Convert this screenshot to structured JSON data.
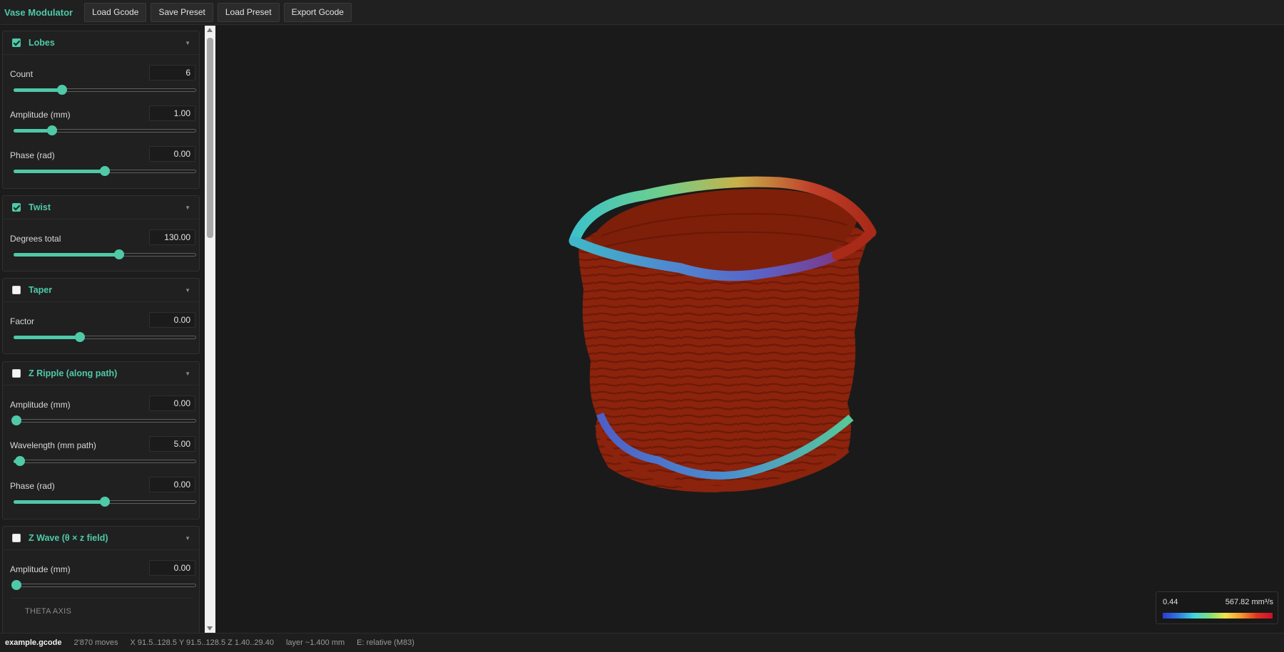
{
  "app": {
    "title": "Vase Modulator",
    "buttons": [
      "Load Gcode",
      "Save Preset",
      "Load Preset",
      "Export Gcode"
    ]
  },
  "panels": {
    "lobes": {
      "title": "Lobes",
      "enabled": true,
      "rows": [
        {
          "label": "Count",
          "value": "6",
          "slider_fraction": 0.26
        },
        {
          "label": "Amplitude (mm)",
          "value": "1.00",
          "slider_fraction": 0.2
        },
        {
          "label": "Phase (rad)",
          "value": "0.00",
          "slider_fraction": 0.5
        }
      ]
    },
    "twist": {
      "title": "Twist",
      "enabled": true,
      "rows": [
        {
          "label": "Degrees total",
          "value": "130.00",
          "slider_fraction": 0.58
        }
      ]
    },
    "taper": {
      "title": "Taper",
      "enabled": false,
      "rows": [
        {
          "label": "Factor",
          "value": "0.00",
          "slider_fraction": 0.36
        }
      ]
    },
    "zripple": {
      "title": "Z Ripple (along path)",
      "enabled": false,
      "rows": [
        {
          "label": "Amplitude (mm)",
          "value": "0.00",
          "slider_fraction": 0.0
        },
        {
          "label": "Wavelength (mm path)",
          "value": "5.00",
          "slider_fraction": 0.02
        },
        {
          "label": "Phase (rad)",
          "value": "0.00",
          "slider_fraction": 0.5
        }
      ]
    },
    "zwave": {
      "title": "Z Wave (θ × z field)",
      "enabled": false,
      "rows": [
        {
          "label": "Amplitude (mm)",
          "value": "0.00",
          "slider_fraction": 0.0
        }
      ],
      "subsection": "THETA AXIS"
    }
  },
  "legend": {
    "min": "0.44",
    "max": "567.82 mm³/s",
    "colors": [
      "#2b3cd0",
      "#2f7be0",
      "#3fd6e0",
      "#7fe07a",
      "#f3e24a",
      "#f39a2e",
      "#e0341f",
      "#c8102c"
    ]
  },
  "status": {
    "file": "example.gcode",
    "moves": "2'870 moves",
    "bounds": "X 91.5..128.5 Y 91.5..128.5 Z 1.40..29.40",
    "layer": "layer ~1.400 mm",
    "extrusion": "E: relative (M83)"
  },
  "colors": {
    "accent": "#4fc9a8",
    "vase_body": "#8c230d",
    "background": "#1a1a1a"
  }
}
